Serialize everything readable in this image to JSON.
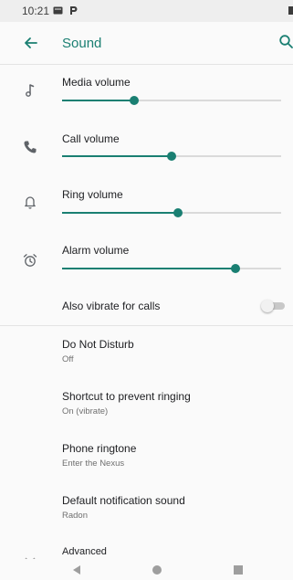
{
  "status_bar": {
    "time": "10:21"
  },
  "app_bar": {
    "title": "Sound"
  },
  "volumes": [
    {
      "label": "Media volume",
      "icon": "music-note-icon",
      "level": 0.33
    },
    {
      "label": "Call volume",
      "icon": "phone-icon",
      "level": 0.5
    },
    {
      "label": "Ring volume",
      "icon": "bell-icon",
      "level": 0.53
    },
    {
      "label": "Alarm volume",
      "icon": "alarm-clock-icon",
      "level": 0.79
    }
  ],
  "vibrate": {
    "label": "Also vibrate for calls",
    "on": false
  },
  "settings": [
    {
      "title": "Do Not Disturb",
      "summary": "Off"
    },
    {
      "title": "Shortcut to prevent ringing",
      "summary": "On (vibrate)"
    },
    {
      "title": "Phone ringtone",
      "summary": "Enter the Nexus"
    },
    {
      "title": "Default notification sound",
      "summary": "Radon"
    },
    {
      "title": "Advanced",
      "summary": ""
    }
  ],
  "colors": {
    "accent": "#1a7f72",
    "track": "#dadada",
    "icon": "#5f6368"
  }
}
